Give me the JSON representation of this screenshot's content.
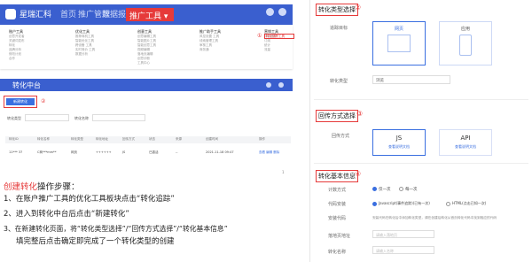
{
  "nav": {
    "brand": "星瑞汇科",
    "items": [
      "首页",
      "推广管理",
      "数据报告"
    ],
    "active": "推广工具 ▾"
  },
  "mega": {
    "columns": [
      {
        "head": "账户工具",
        "items": [
          "创意开发者",
          "关键词发布",
          "转化",
          "品牌分析",
          "修改计划",
          "合作"
        ]
      },
      {
        "head": "优化工具",
        "items": [
          "推荐商机工具",
          "智能优化工具",
          "跨设备 工具",
          "实时竞价 工具",
          "数据分析"
        ]
      },
      {
        "head": "创意工具",
        "items": [
          "创意编辑工具",
          "智能图片工具",
          "智能创意工具",
          "视频编辑",
          "落地页编辑",
          "创意诊断",
          "工具中心"
        ]
      },
      {
        "head": "推广助手工具",
        "items": [
          "风控设置 工具",
          "线索管理工具",
          "审核工具",
          "商务通"
        ]
      },
      {
        "head": "营销工具",
        "items": [
          "转化追踪",
          "订阅",
          "统计",
          "流量"
        ]
      }
    ],
    "track": "转化追踪工具",
    "badge": "①"
  },
  "center": {
    "title": "转化中台",
    "new_btn": "新建转化",
    "badge": "②",
    "filter_label1": "转化类型",
    "filter_label2": "转化名称",
    "table": {
      "headers": [
        "转化ID",
        "转化名称",
        "转化类型",
        "转化地址",
        "回传方式",
        "状态",
        "来源",
        "创建时间",
        "操作"
      ],
      "row": [
        "11*** 37",
        "C商***mm**",
        "网页",
        "++++++",
        "JS",
        "已激活",
        "--",
        "2021-11-18 09:47",
        "查看 编辑 删除"
      ]
    },
    "pager": "1"
  },
  "steps": {
    "title_hl": "创建转化",
    "title_rest": "操作步骤：",
    "lines": [
      "1、在账户推广工具的优化工具板块点击“转化追踪”",
      "2、进入到转化中台后点击“新建转化”",
      "3、在新建转化页面，将“转化类型选择”/“回传方式选择”/“转化基本信息”",
      "填完整后点击确定即完成了一个转化类型的创建"
    ]
  },
  "right": {
    "s1": {
      "title": "转化类型选择",
      "badge": "②",
      "row1_label": "追踪目标",
      "card_web": "网页",
      "card_app": "应用",
      "row2_label": "转化类型",
      "select_value": "浏览"
    },
    "s2": {
      "title": "回传方式选择",
      "badge": "③",
      "row_label": "回传方式",
      "js": "JS",
      "js_link": "查看说明文档",
      "api": "API",
      "api_link": "查看说明文档"
    },
    "s3": {
      "title": "转化基本信息",
      "badge": "④",
      "r1_label": "计数方式",
      "r1_opt1": "仅一次",
      "r1_opt2": "每一次",
      "r2_label": "代码安装",
      "r2_opt1": "Javascript(事件追踪)(已有一次)",
      "r2_opt2": "HTML(点击已知一次)",
      "r3_label": "安装代码",
      "r3_text": "安装代码在转化后中添加转化类型，请在创建后转化从首页转化代码中找到相应的代码",
      "r4_label": "落地页地址",
      "r4_ph": "请输入落地页",
      "r5_label": "转化名称",
      "r5_ph": "请输入名称"
    }
  },
  "colors": {
    "brand_blue": "#3a5fcf",
    "accent_red": "#e63a3a",
    "link_blue": "#3a6fe0"
  }
}
